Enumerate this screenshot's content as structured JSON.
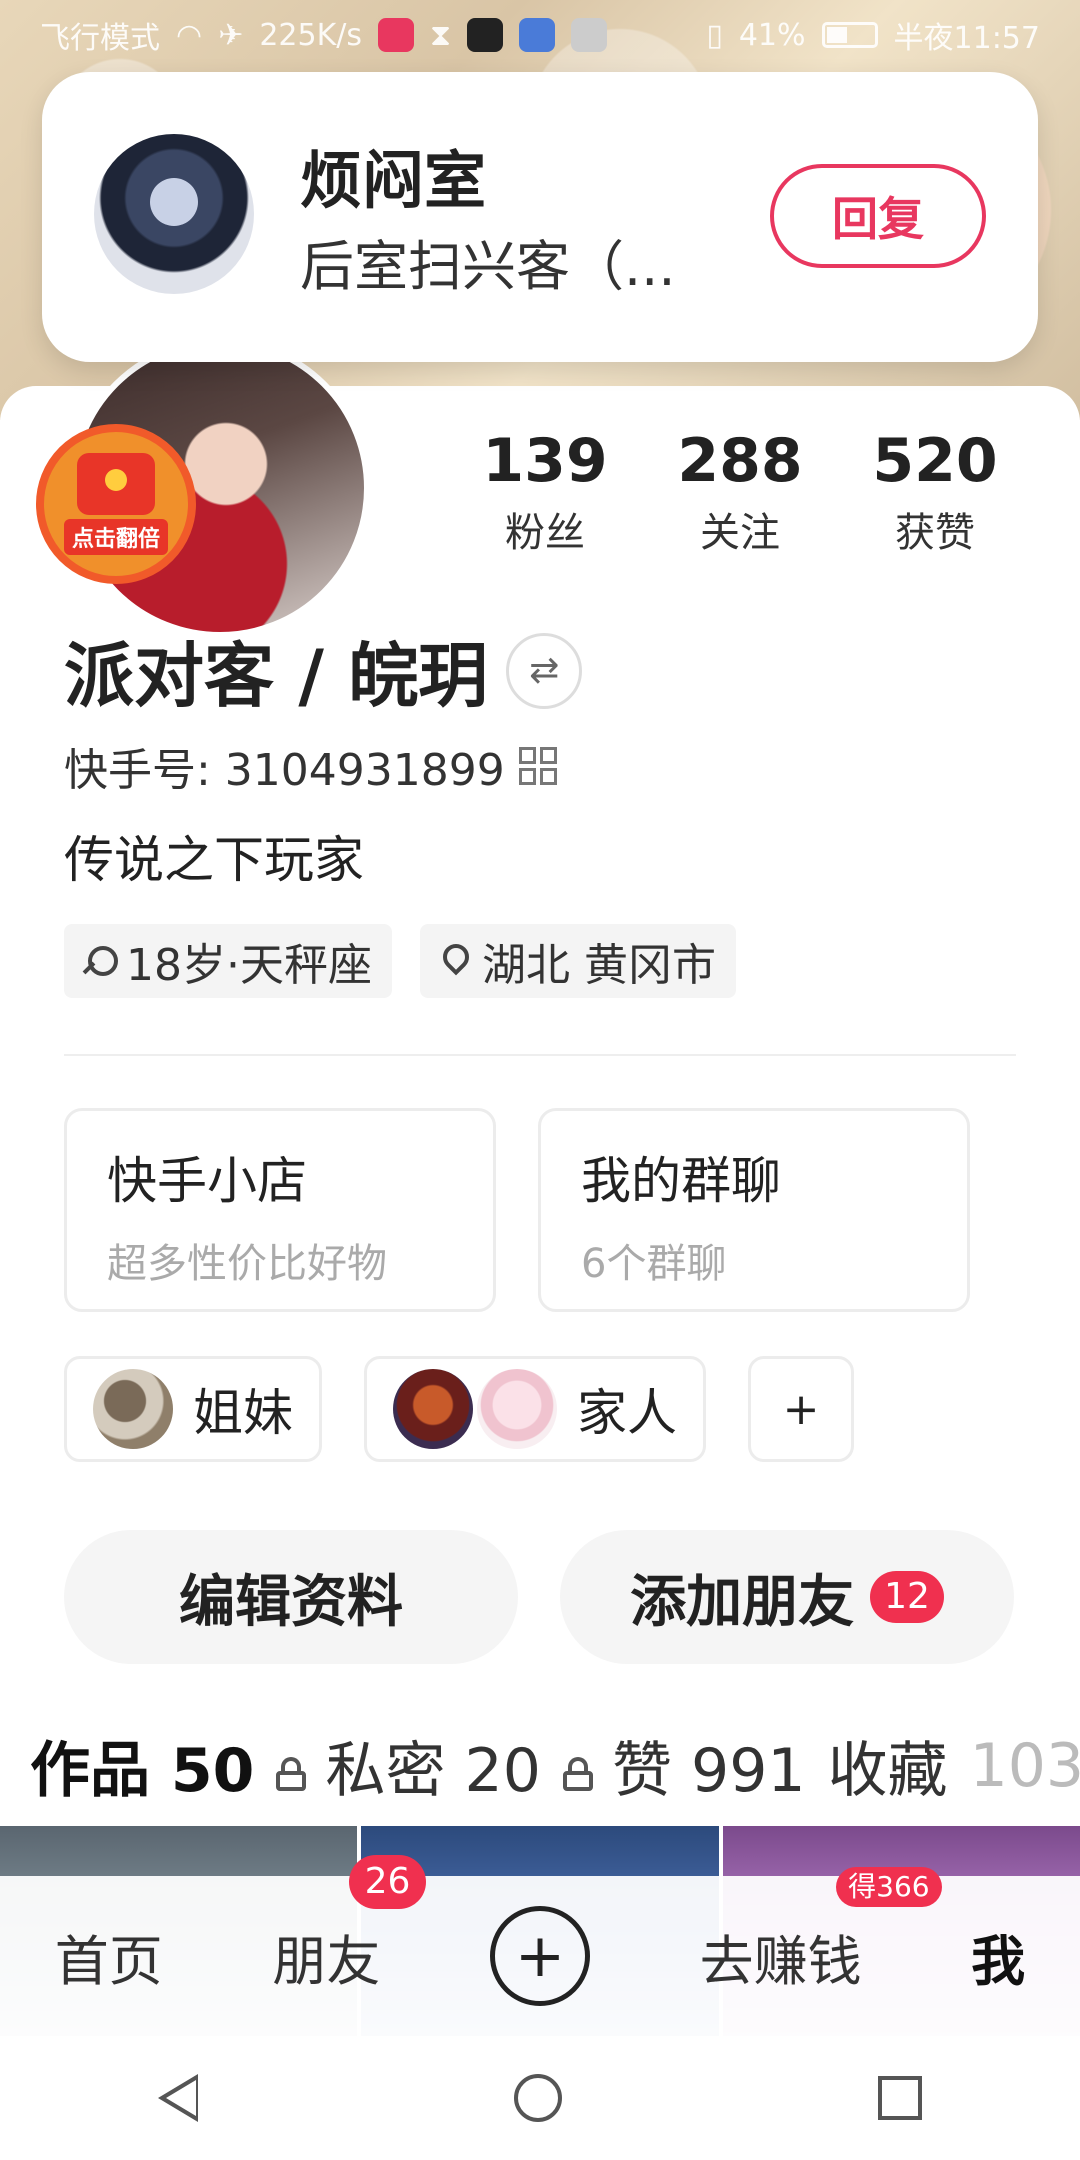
{
  "status_bar": {
    "left": "飞行模式",
    "speed": "225K/s",
    "battery": "41%",
    "time": "半夜11:57"
  },
  "notification": {
    "title": "烦闷室",
    "message": "后室扫兴客（...",
    "reply_label": "回复"
  },
  "red_packet": {
    "label": "点击翻倍"
  },
  "stats": [
    {
      "value": "139",
      "label": "粉丝"
    },
    {
      "value": "288",
      "label": "关注"
    },
    {
      "value": "520",
      "label": "获赞"
    }
  ],
  "profile": {
    "name": "派对客 / 皖玥",
    "kuaishou_id": "快手号: 3104931899",
    "bio": "传说之下玩家",
    "tags": [
      {
        "icon": "gender-icon",
        "text": "18岁·天秤座"
      },
      {
        "icon": "location-pin-icon",
        "text": "湖北 黄冈市"
      }
    ]
  },
  "cards": [
    {
      "title": "快手小店",
      "subtitle": "超多性价比好物"
    },
    {
      "title": "我的群聊",
      "subtitle": "6个群聊"
    }
  ],
  "groups": [
    {
      "label": "姐妹"
    },
    {
      "label": "家人"
    }
  ],
  "group_add_label": "+",
  "actions": {
    "edit_label": "编辑资料",
    "add_friend_label": "添加朋友",
    "add_friend_badge": "12"
  },
  "tabs": [
    {
      "label": "作品 50"
    },
    {
      "label": "私密 20"
    },
    {
      "label": "赞 991"
    },
    {
      "label": "收藏"
    },
    {
      "label": "103"
    }
  ],
  "bottom_nav": {
    "home": "首页",
    "friends": "朋友",
    "friends_badge": "26",
    "plus": "+",
    "earn": "去赚钱",
    "earn_badge": "得366",
    "me": "我"
  },
  "colors": {
    "accent": "#e8375f",
    "badge": "#f0304f"
  }
}
